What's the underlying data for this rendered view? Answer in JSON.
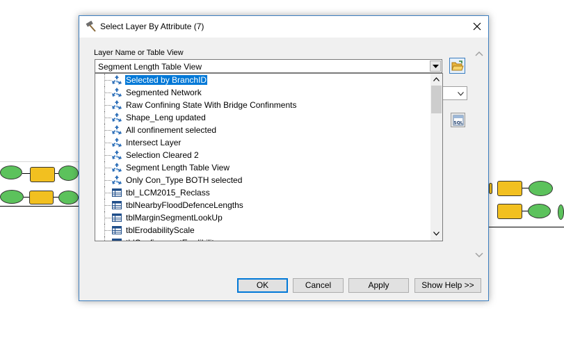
{
  "dialog": {
    "title": "Select Layer By Attribute (7)",
    "field_label": "Layer Name or Table View",
    "selected_layer": "Segment Length Table View",
    "layer_options": [
      {
        "label": "Selected by BranchID",
        "type": "layer",
        "selected": true
      },
      {
        "label": "Segmented Network",
        "type": "layer",
        "selected": false
      },
      {
        "label": "Raw Confining State With Bridge Confinments",
        "type": "layer",
        "selected": false
      },
      {
        "label": "Shape_Leng updated",
        "type": "layer",
        "selected": false
      },
      {
        "label": "All confinement selected",
        "type": "layer",
        "selected": false
      },
      {
        "label": "Intersect Layer",
        "type": "layer",
        "selected": false
      },
      {
        "label": "Selection Cleared 2",
        "type": "layer",
        "selected": false
      },
      {
        "label": "Segment Length Table View",
        "type": "layer",
        "selected": false
      },
      {
        "label": "Only Con_Type BOTH selected",
        "type": "layer",
        "selected": false
      },
      {
        "label": "tbl_LCM2015_Reclass",
        "type": "table",
        "selected": false
      },
      {
        "label": "tblNearbyFloodDefenceLengths",
        "type": "table",
        "selected": false
      },
      {
        "label": "tblMarginSegmentLookUp",
        "type": "table",
        "selected": false
      },
      {
        "label": "tblErodabilityScale",
        "type": "table",
        "selected": false
      },
      {
        "label": "tblConfinementErodibility",
        "type": "table",
        "selected": false
      }
    ],
    "buttons": {
      "ok": "OK",
      "cancel": "Cancel",
      "apply": "Apply",
      "help": "Show Help >>"
    },
    "icons": {
      "title": "hammer-icon",
      "browse": "open-folder-icon",
      "sql": "sql-icon",
      "close": "close-icon"
    },
    "sql_icon_text": "SQL"
  },
  "colors": {
    "selection": "#0078d7",
    "dialog_border": "#3c7ebf",
    "layer_icon": "#2e6fb8"
  }
}
